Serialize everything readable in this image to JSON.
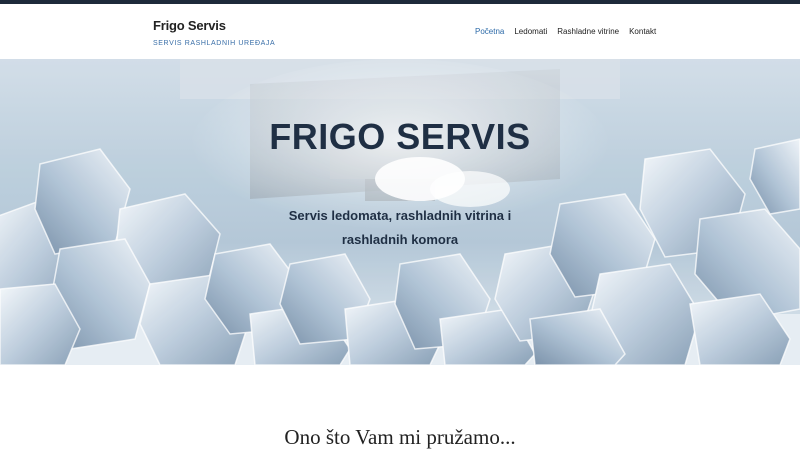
{
  "site": {
    "title": "Frigo Servis",
    "tagline": "SERVIS RASHLADNIH UREĐAJA"
  },
  "nav": {
    "items": [
      {
        "label": "Početna",
        "active": true
      },
      {
        "label": "Ledomati",
        "active": false
      },
      {
        "label": "Rashladne vitrine",
        "active": false
      },
      {
        "label": "Kontakt",
        "active": false
      }
    ]
  },
  "hero": {
    "title": "FRIGO SERVIS",
    "subtitle_line1": "Servis ledomata, rashladnih vitrina i",
    "subtitle_line2": "rashladnih komora",
    "background": "ice-cubes-image"
  },
  "section": {
    "heading": "Ono što Vam mi pružamo..."
  },
  "colors": {
    "top_strip": "#1d2a3a",
    "accent": "#2c6aa8",
    "hero_text": "#1f2f44"
  }
}
